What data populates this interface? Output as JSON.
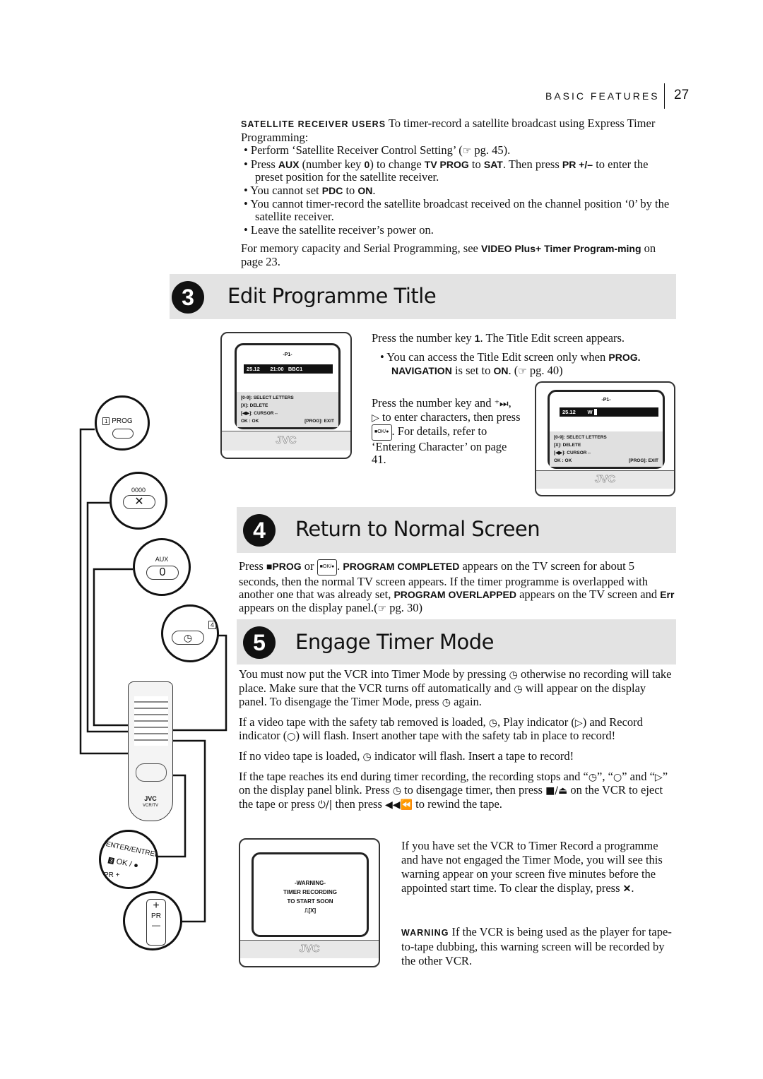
{
  "header": {
    "section": "BASIC FEATURES",
    "page": "27"
  },
  "satellite": {
    "intro": [
      {
        "t": "SATELLITE RECEIVER USERS",
        "s": 1
      },
      {
        "t": "  To timer-record a satellite broadcast using Express Timer Programming:"
      }
    ],
    "bullets": [
      [
        {
          "t": "Perform ‘Satellite Receiver Control Setting’ ("
        },
        {
          "i": "☞"
        },
        {
          "t": " pg. 45)."
        }
      ],
      [
        {
          "t": "Press "
        },
        {
          "t": "AUX",
          "b": 1
        },
        {
          "t": " (number key "
        },
        {
          "t": "0",
          "b": 1
        },
        {
          "t": ") to change "
        },
        {
          "t": "TV PROG",
          "b": 1
        },
        {
          "t": " to "
        },
        {
          "t": "SAT",
          "b": 1
        },
        {
          "t": ". Then press "
        },
        {
          "t": "PR +/–",
          "b": 1
        },
        {
          "t": " to enter the preset position for the satellite receiver."
        }
      ],
      [
        {
          "t": "You cannot set "
        },
        {
          "t": "PDC",
          "b": 1
        },
        {
          "t": " to "
        },
        {
          "t": "ON",
          "b": 1
        },
        {
          "t": "."
        }
      ],
      [
        {
          "t": "You cannot timer-record the satellite broadcast received on the channel position ‘0’ by the satellite receiver."
        }
      ],
      [
        {
          "t": "Leave the satellite receiver’s power on."
        }
      ]
    ],
    "memory": [
      {
        "t": "For memory capacity and Serial Programming, see "
      },
      {
        "t": "VIDEO Plus+ Timer Program-ming",
        "b": 1
      },
      {
        "t": " on page 23."
      }
    ]
  },
  "section3": {
    "number": "3",
    "title": "Edit Programme Title",
    "p1": [
      {
        "t": "Press the number key "
      },
      {
        "t": "1",
        "b": 1
      },
      {
        "t": ". The Title Edit screen appears."
      }
    ],
    "bullet": [
      {
        "t": "You can access the Title Edit screen only when "
      },
      {
        "t": "PROG. NAVIGATION",
        "b": 1
      },
      {
        "t": " is set to "
      },
      {
        "t": "ON",
        "b": 1
      },
      {
        "t": ". ("
      },
      {
        "i": "☞"
      },
      {
        "t": " pg. 40)"
      }
    ],
    "p2": [
      {
        "t": "Press the number key and "
      },
      {
        "i": "⁺⏭"
      },
      {
        "t": ", "
      },
      {
        "i": "▷"
      },
      {
        "t": " to enter characters, then press "
      },
      {
        "ok": "■OK/●"
      },
      {
        "t": ". For details, refer to ‘Entering Character’ on page 41."
      }
    ],
    "tv1": {
      "title": "-P1-",
      "date": "25.12",
      "time": "21:00",
      "channel": "BBC1",
      "menu": [
        "[0-9]: SELECT LETTERS",
        "[X]: DELETE",
        "[◀▶]: CURSOR↔"
      ],
      "ok": "OK : OK",
      "exit": "[PROG]: EXIT",
      "brand": "JVC"
    },
    "tv2": {
      "title": "-P1-",
      "date": "25.12",
      "entry": "W",
      "menu": [
        "[0-9]: SELECT LETTERS",
        "[X]: DELETE",
        "[◀▶]: CURSOR↔"
      ],
      "ok": "OK : OK",
      "exit": "[PROG]: EXIT",
      "brand": "JVC"
    }
  },
  "section4": {
    "number": "4",
    "title": "Return to Normal Screen",
    "p": [
      {
        "t": "Press "
      },
      {
        "t": "■PROG",
        "b": 1
      },
      {
        "t": " or "
      },
      {
        "ok": "■OK/●"
      },
      {
        "t": ". "
      },
      {
        "t": "PROGRAM COMPLETED",
        "b": 1
      },
      {
        "t": " appears on the TV screen for about 5 seconds, then the normal TV screen appears. If the timer programme is overlapped with another one that was already set, "
      },
      {
        "t": "PROGRAM OVERLAPPED",
        "b": 1
      },
      {
        "t": " appears on the TV screen and "
      },
      {
        "t": "Err",
        "b": 1
      },
      {
        "t": " appears on the display panel.("
      },
      {
        "i": "☞"
      },
      {
        "t": " pg. 30)"
      }
    ]
  },
  "section5": {
    "number": "5",
    "title": "Engage Timer Mode",
    "paras": [
      [
        {
          "t": "You must now put the VCR into Timer Mode by pressing "
        },
        {
          "i": "◷"
        },
        {
          "t": " otherwise no recording will take place. Make sure that the VCR turns off automatically and "
        },
        {
          "i": "◷"
        },
        {
          "t": " will appear on the display panel. To disengage the Timer Mode, press "
        },
        {
          "i": "◷"
        },
        {
          "t": " again."
        }
      ],
      [
        {
          "t": "If a video tape with the safety tab removed is loaded, "
        },
        {
          "i": "◷"
        },
        {
          "t": ", Play indicator ("
        },
        {
          "i": "▷"
        },
        {
          "t": ") and Record indicator ("
        },
        {
          "i": "○"
        },
        {
          "t": ") will flash. Insert another tape with the safety tab in place to record!"
        }
      ],
      [
        {
          "t": "If no video tape is loaded, "
        },
        {
          "i": "◷"
        },
        {
          "t": " indicator will flash. Insert a tape to record!"
        }
      ],
      [
        {
          "t": "If the tape reaches its end during timer recording, the recording stops and “"
        },
        {
          "i": "◷"
        },
        {
          "t": "”, “"
        },
        {
          "i": "○"
        },
        {
          "t": "” and “"
        },
        {
          "i": "▷"
        },
        {
          "t": "” on the display panel blink. Press "
        },
        {
          "i": "◷"
        },
        {
          "t": " to disengage timer, then press "
        },
        {
          "i": "■/⏏"
        },
        {
          "t": " on the VCR to eject the tape or press "
        },
        {
          "i": "⏻/|"
        },
        {
          "t": " then press "
        },
        {
          "i": "◀◀⏪"
        },
        {
          "t": " to rewind the tape."
        }
      ]
    ],
    "tv3": {
      "lines": [
        "-WARNING-",
        "TIMER RECORDING",
        "TO START SOON"
      ],
      "key": "⎍[X]",
      "brand": "JVC"
    },
    "warnp": [
      {
        "t": "If you have set the VCR to Timer Record a programme and have not engaged the Timer Mode, you will see this warning appear on your screen five minutes before the appointed start time. To clear the display, press "
      },
      {
        "t": "✕",
        "b": 1
      },
      {
        "t": "."
      }
    ],
    "note": [
      {
        "t": "WARNING",
        "s": 1
      },
      {
        "t": " If the VCR is being used as the player for tape-to-tape dubbing, this warning screen will be recorded by the other VCR."
      }
    ]
  },
  "remote": {
    "prog_key": "1",
    "prog": "PROG",
    "clear_label": "0000",
    "aux": "AUX",
    "zero": "0",
    "timer_badge": "4",
    "enter": "ENTER/ENTREE",
    "ok_key": "3",
    "ok": "OK /",
    "pr_plus": "PR +",
    "pr": "PR",
    "plus": "+",
    "minus": "—",
    "brand": "JVC",
    "model": "VCR/TV"
  }
}
